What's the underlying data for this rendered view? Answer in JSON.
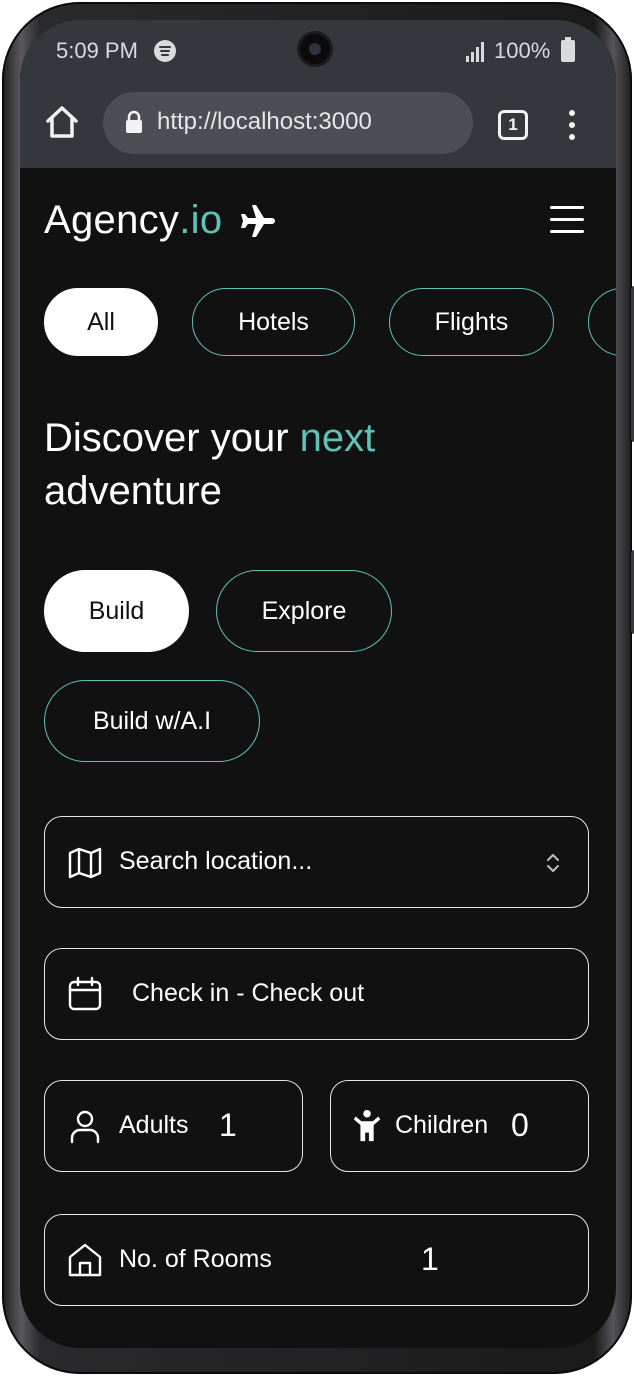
{
  "status_bar": {
    "time": "5:09 PM",
    "battery": "100%"
  },
  "browser": {
    "url": "http://localhost:3000",
    "tab_count": "1"
  },
  "header": {
    "brand_main": "Agency",
    "brand_accent": ".io"
  },
  "categories": [
    {
      "label": "All",
      "active": true
    },
    {
      "label": "Hotels",
      "active": false
    },
    {
      "label": "Flights",
      "active": false
    }
  ],
  "hero": {
    "line1": "Discover your ",
    "accent": "next",
    "line2": "adventure"
  },
  "modes": [
    {
      "label": "Build",
      "active": true
    },
    {
      "label": "Explore",
      "active": false
    },
    {
      "label": "Build w/A.I",
      "active": false
    }
  ],
  "form": {
    "location_placeholder": "Search location...",
    "dates_label": "Check in - Check out",
    "adults_label": "Adults",
    "adults_value": "1",
    "children_label": "Children",
    "children_value": "0",
    "rooms_label": "No. of Rooms",
    "rooms_value": "1"
  },
  "colors": {
    "accent": "#5ec2b7",
    "background": "#111111",
    "chrome": "#34373b"
  }
}
